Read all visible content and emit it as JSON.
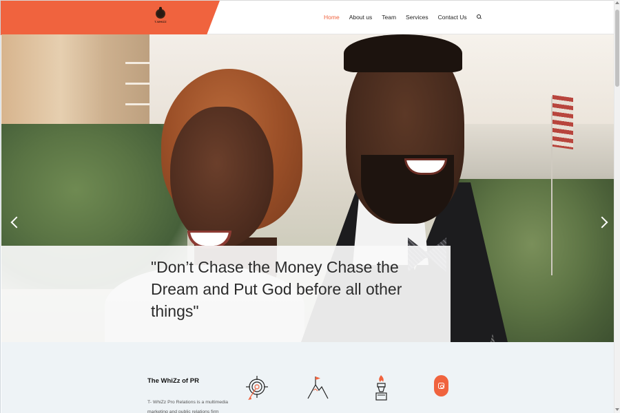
{
  "header": {
    "logo_text": "T-WHIZZ",
    "nav": [
      {
        "label": "Home",
        "active": true
      },
      {
        "label": "About us",
        "active": false
      },
      {
        "label": "Team",
        "active": false
      },
      {
        "label": "Services",
        "active": false
      },
      {
        "label": "Contact Us",
        "active": false
      }
    ],
    "search_icon": "search-icon"
  },
  "hero": {
    "quote": "\"Don’t Chase the Money Chase the Dream and Put God before all other things\"",
    "prev_icon": "chevron-left-icon",
    "next_icon": "chevron-right-icon"
  },
  "about": {
    "title": "The WhiZz of PR",
    "text": "T- WhiZz Pro Relations is a multimedia marketing and public relations firm"
  },
  "features": [
    {
      "icon": "target-icon"
    },
    {
      "icon": "mountain-flag-icon"
    },
    {
      "icon": "torch-icon"
    }
  ],
  "social": {
    "icon": "instagram-icon"
  },
  "colors": {
    "accent": "#f0633e",
    "section_bg": "#eef3f6",
    "text": "#2b2b2b"
  }
}
